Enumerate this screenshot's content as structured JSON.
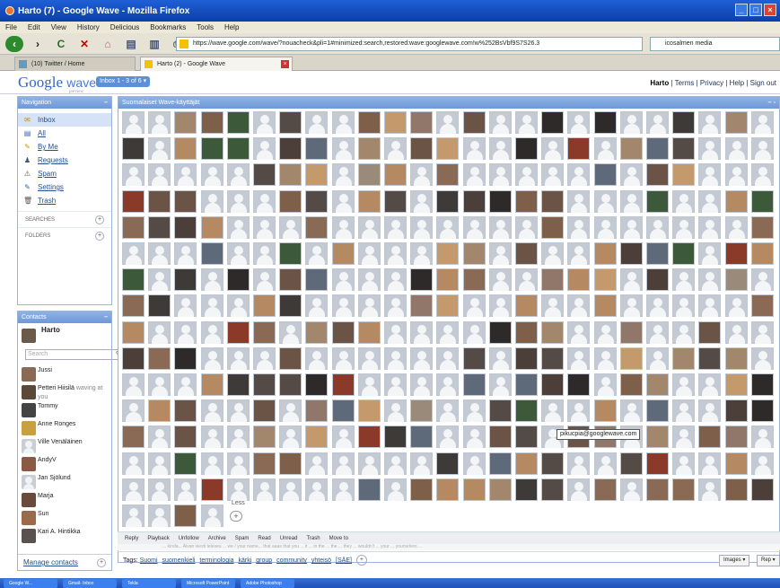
{
  "browser": {
    "title": "Harto (7) - Google Wave - Mozilla Firefox",
    "menu": [
      "File",
      "Edit",
      "View",
      "History",
      "Delicious",
      "Bookmarks",
      "Tools",
      "Help"
    ],
    "url": "https://wave.google.com/wave/?nouacheck&pli=1#minimized:search,restored:wave:googlewave.com!w%252BsVbf9S7S26.3",
    "search_placeholder": "icosalmen media",
    "tabs": [
      {
        "label": "(10) Twitter / Home"
      },
      {
        "label": "Harto (2) - Google Wave"
      }
    ]
  },
  "header": {
    "logo": "Google",
    "logo_word": "wave",
    "preview": "preview",
    "inbox_pill": "Inbox 1 - 3 of 6 ▾",
    "user": "Harto",
    "links": "| Terms | Privacy | Help | Sign out"
  },
  "navigation": {
    "title": "Navigation",
    "items": [
      {
        "label": "Inbox",
        "icon": "inbox-icon"
      },
      {
        "label": "All",
        "icon": "all-icon"
      },
      {
        "label": "By Me",
        "icon": "pencil-icon"
      },
      {
        "label": "Requests",
        "icon": "request-icon"
      },
      {
        "label": "Spam",
        "icon": "spam-icon"
      },
      {
        "label": "Settings",
        "icon": "settings-icon"
      },
      {
        "label": "Trash",
        "icon": "trash-icon"
      }
    ],
    "searches": "SEARCHES",
    "folders": "FOLDERS"
  },
  "contacts": {
    "title": "Contacts",
    "me": "Harto",
    "search_placeholder": "Search",
    "list": [
      {
        "name": "Jussi",
        "note": ""
      },
      {
        "name": "Petteri Hiisilä",
        "note": "waving at you"
      },
      {
        "name": "Tommy",
        "note": ""
      },
      {
        "name": "Anne Ronges",
        "note": ""
      },
      {
        "name": "Ville Venäläinen",
        "note": ""
      },
      {
        "name": "AndyV",
        "note": ""
      },
      {
        "name": "Jan Sjölund",
        "note": ""
      },
      {
        "name": "Marja",
        "note": ""
      },
      {
        "name": "Sun",
        "note": ""
      },
      {
        "name": "Kari A. Hintikka",
        "note": ""
      }
    ],
    "manage": "Manage contacts"
  },
  "wave": {
    "title": "Suomalaiset Wave-käyttäjät",
    "tooltip": "pikucpia@googlewave.com",
    "less": "Less",
    "actions": [
      "Reply",
      "Playback",
      "Unfollow",
      "Archive",
      "Spam",
      "Read",
      "Unread",
      "Trash",
      "Move to"
    ],
    "blur_text": "... kinda... Aivan viesti teleseu ... we / your name... that aaas that you ... it ... in the ... the ... they ... wouldn't ... your ... yourselves ...",
    "tags_label": "Tags:",
    "tags": [
      "Suomi",
      "suomenkieli",
      "terminologia",
      "kärki",
      "group",
      "community",
      "yhteisö",
      "[SÄE]"
    ],
    "images_btn": "Images ▾",
    "reply_btn": "Rep ▾"
  },
  "taskbar": [
    "Google W...",
    "Gmail- Inbox",
    "Tekla",
    "Microsoft PowerPoint",
    "Adobe Photoshop"
  ]
}
